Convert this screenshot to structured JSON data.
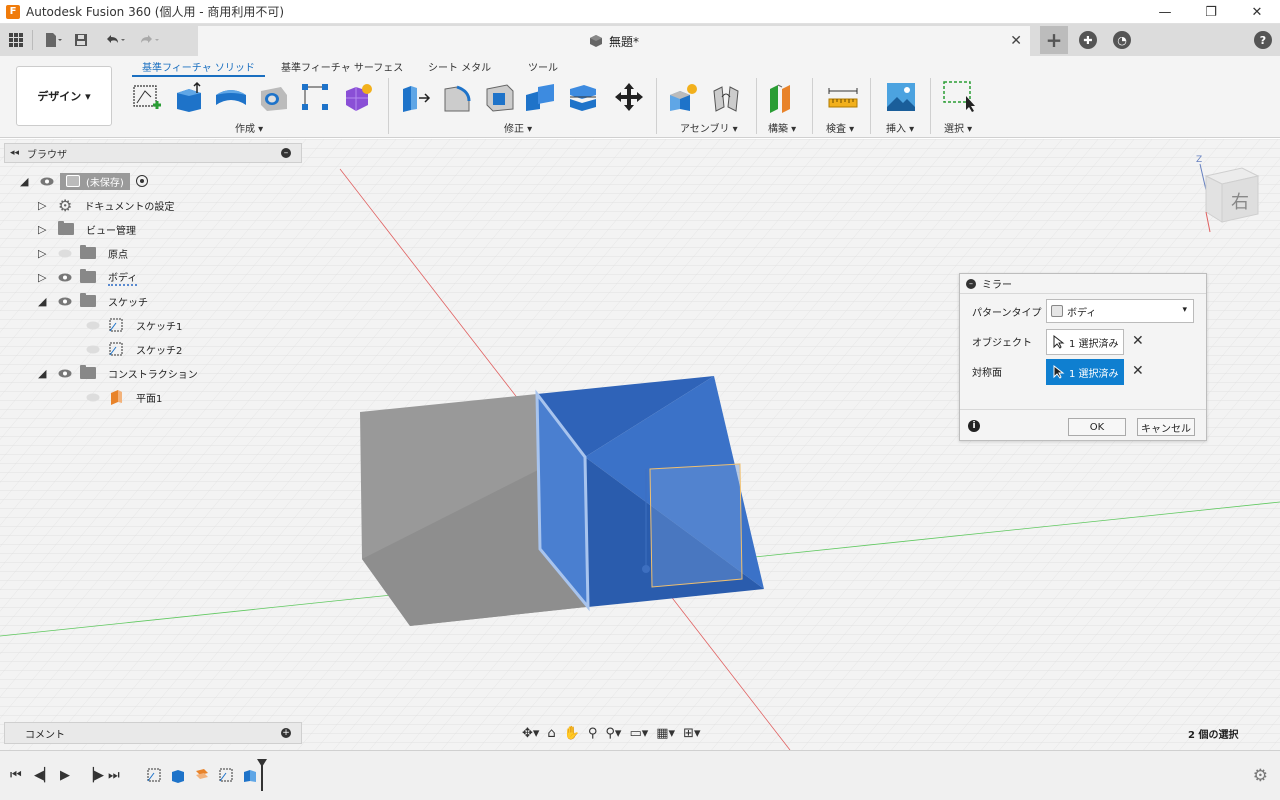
{
  "window": {
    "title": "Autodesk Fusion 360 (個人用 - 商用利用不可)",
    "minimize": "—",
    "maximize": "❐",
    "close": "✕"
  },
  "document_tab": {
    "title": "無題*",
    "close": "✕"
  },
  "workspace": {
    "label": "デザイン ▾"
  },
  "ribbon": {
    "tabs": [
      "基準フィーチャ ソリッド",
      "基準フィーチャ サーフェス",
      "シート メタル",
      "ツール"
    ],
    "active_tab": 0,
    "groups": [
      {
        "label": "作成 ▾"
      },
      {
        "label": "修正 ▾"
      },
      {
        "label": "アセンブリ ▾"
      },
      {
        "label": "構築 ▾"
      },
      {
        "label": "検査 ▾"
      },
      {
        "label": "挿入 ▾"
      },
      {
        "label": "選択 ▾"
      }
    ]
  },
  "browser": {
    "title": "ブラウザ",
    "items": [
      {
        "label": "(未保存)"
      },
      {
        "label": "ドキュメントの設定"
      },
      {
        "label": "ビュー管理"
      },
      {
        "label": "原点"
      },
      {
        "label": "ボディ"
      },
      {
        "label": "スケッチ"
      },
      {
        "label": "スケッチ1"
      },
      {
        "label": "スケッチ2"
      },
      {
        "label": "コンストラクション"
      },
      {
        "label": "平面1"
      }
    ]
  },
  "mirror_dialog": {
    "title": "ミラー",
    "pattern_type_label": "パターンタイプ",
    "pattern_type_value": "ボディ",
    "objects_label": "オブジェクト",
    "objects_value": "1 選択済み",
    "mirror_plane_label": "対称面",
    "mirror_plane_value": "1 選択済み",
    "ok": "OK",
    "cancel": "キャンセル"
  },
  "viewcube": {
    "face_label": "右",
    "axis_z": "Z"
  },
  "comments": {
    "label": "コメント"
  },
  "status": {
    "selection": "2 個の選択"
  },
  "colors": {
    "accent": "#0f7fd0",
    "body_blue": "#2f6cc4",
    "body_gray": "#9a9a9a"
  }
}
